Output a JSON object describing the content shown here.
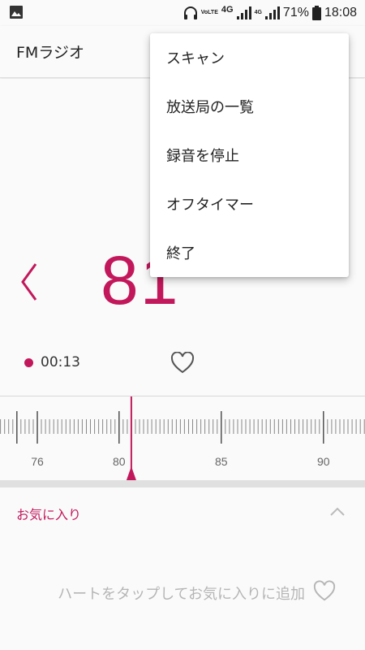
{
  "status": {
    "volte": "VoLTE",
    "net1": "4G",
    "net2": "4G",
    "battery": "71%",
    "time": "18:08"
  },
  "app": {
    "title": "FMラジオ"
  },
  "player": {
    "frequency": "81",
    "recording_time": "00:13"
  },
  "dial": {
    "ticks": [
      "76",
      "80",
      "85",
      "90"
    ],
    "current_marker": 80.6
  },
  "favorites": {
    "title": "お気に入り",
    "empty_hint": "ハートをタップしてお気に入りに追加"
  },
  "menu": {
    "items": [
      {
        "label": "スキャン"
      },
      {
        "label": "放送局の一覧"
      },
      {
        "label": "録音を停止"
      },
      {
        "label": "オフタイマー"
      },
      {
        "label": "終了"
      }
    ]
  },
  "colors": {
    "accent": "#c2185b"
  },
  "icons": [
    "image-icon",
    "headphones-icon",
    "signal-icon",
    "battery-icon",
    "chevron-left-icon",
    "heart-outline-icon",
    "chevron-up-icon"
  ]
}
